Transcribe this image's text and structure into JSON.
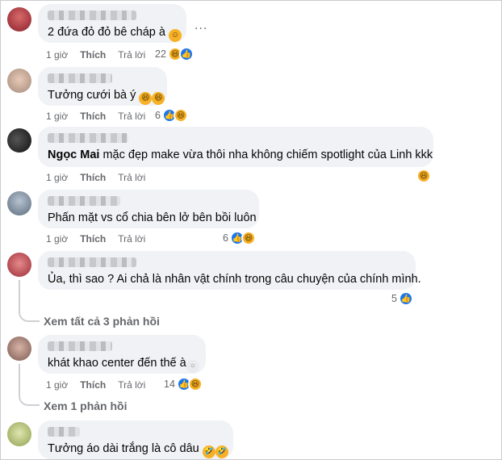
{
  "actions": {
    "time": "1 giờ",
    "like": "Thích",
    "reply": "Trả lời"
  },
  "more_label": "...",
  "colors": {
    "bubble": "#f0f2f5",
    "like": "#1877f2",
    "haha": "#f7b125",
    "meta": "#65676b"
  },
  "comments": [
    {
      "text": "2 đứa đỏ đỏ bê cháp à",
      "emoji": "grinning-emoji",
      "reactions": "22",
      "icons": [
        "haha-icon",
        "like-icon"
      ]
    },
    {
      "text": "Tưởng cưới bà ý",
      "emoji": "laughing-emoji",
      "reactions": "6",
      "icons": [
        "like-icon",
        "haha-icon"
      ]
    },
    {
      "mention": "Ngọc Mai",
      "text": " mặc đẹp make vừa thôi nha không chiếm spotlight của Linh kkk",
      "reactions": "",
      "icons": [
        "haha-icon"
      ]
    },
    {
      "text": "Phấn mặt vs cổ chia bên lở bên bồi luôn",
      "reactions": "6",
      "icons": [
        "like-icon",
        "haha-icon"
      ]
    },
    {
      "text": "Ủa, thì sao ? Ai chả là nhân vật chính trong câu chuyện của chính mình.",
      "reactions": "5",
      "icons": [
        "like-icon"
      ],
      "view_replies": "Xem tất cả 3 phản hồi"
    },
    {
      "text": "khát khao center đến thế à",
      "emoji": "neutral-emoji",
      "reactions": "14",
      "icons": [
        "like-icon",
        "haha-icon"
      ],
      "view_replies": "Xem 1 phản hồi"
    },
    {
      "text": "Tưởng áo dài trắng là cô dâu",
      "emoji": "rofl-emoji",
      "reactions": "",
      "icons": []
    }
  ]
}
